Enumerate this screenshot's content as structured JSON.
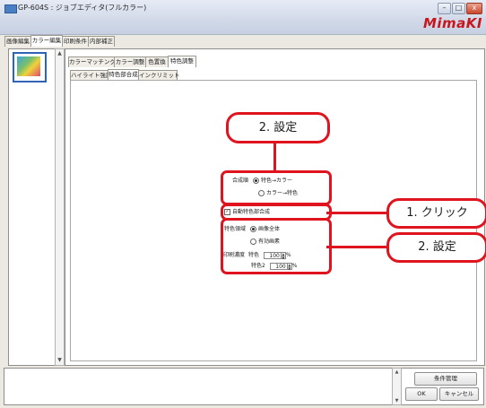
{
  "window": {
    "title": "GP-604S : ジョブエディタ(フルカラー)",
    "brand": "MimaKI",
    "controls": {
      "minimize": "–",
      "maximize": "□",
      "close": "x"
    }
  },
  "main_tabs": [
    {
      "label": "画像編集"
    },
    {
      "label": "カラー編集"
    },
    {
      "label": "印刷条件"
    },
    {
      "label": "内部補正"
    }
  ],
  "main_tab_active_index": 1,
  "sub_tabs": [
    {
      "label": "カラーマッチング"
    },
    {
      "label": "カラー調整"
    },
    {
      "label": "色置換"
    },
    {
      "label": "特色調整"
    }
  ],
  "sub_tabs2": [
    {
      "label": "ハイライト強調"
    },
    {
      "label": "特色部合成"
    },
    {
      "label": "インクリミット"
    }
  ],
  "composite_order": {
    "label": "合成順",
    "option1": "特色→カラー",
    "option2": "カラー→特色",
    "selected": "特色→カラー"
  },
  "auto_composite": {
    "label": "自動特色部合成",
    "checked": true
  },
  "special_area": {
    "label": "特色領域",
    "option1": "画像全体",
    "option2": "有効画素",
    "selected": "画像全体"
  },
  "print_density": {
    "label": "印刷濃度",
    "rows": [
      {
        "label": "特色",
        "value": "100",
        "unit": "%"
      },
      {
        "label": "特色2",
        "value": "100",
        "unit": "%"
      }
    ]
  },
  "callouts": {
    "step_set_top": "2. 設定",
    "step_click": "1. クリック",
    "step_set_right": "2. 設定",
    "accent": "#e0141e"
  },
  "buttons": {
    "condition_manage": "条件管理",
    "ok": "OK",
    "cancel": "キャンセル"
  }
}
